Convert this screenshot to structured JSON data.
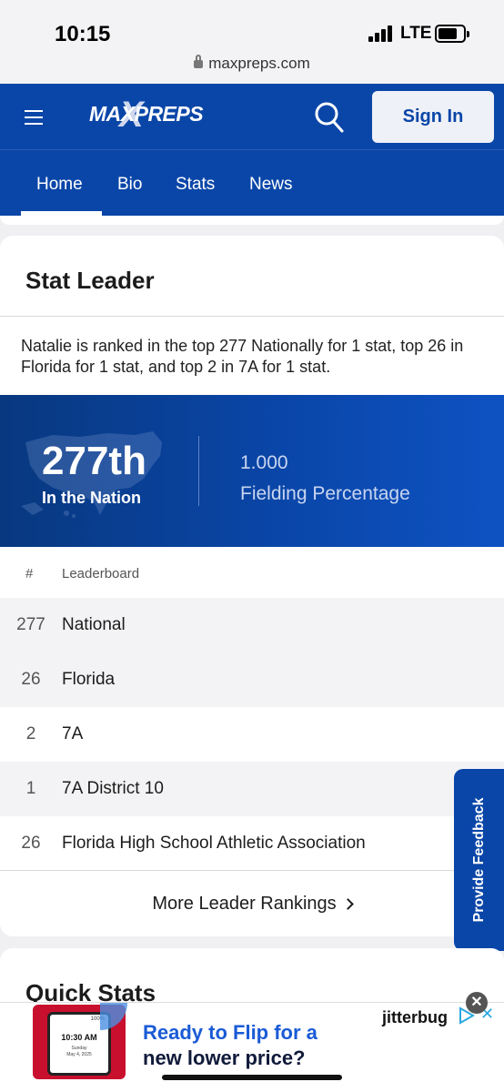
{
  "status_bar": {
    "time": "10:15",
    "network": "LTE",
    "url": "maxpreps.com"
  },
  "header": {
    "logo_text": "MAXPREPS",
    "sign_in_label": "Sign In"
  },
  "nav": {
    "tabs": [
      {
        "label": "Home",
        "active": true
      },
      {
        "label": "Bio"
      },
      {
        "label": "Stats"
      },
      {
        "label": "News"
      }
    ]
  },
  "stat_leader": {
    "title": "Stat Leader",
    "summary": "Natalie is ranked in the top 277 Nationally for 1 stat, top 26 in Florida for 1 stat, and top 2 in 7A for 1 stat.",
    "banner": {
      "rank": "277th",
      "rank_scope": "In the Nation",
      "stat_value": "1.000",
      "stat_name": "Fielding Percentage"
    },
    "table": {
      "headers": [
        "#",
        "Leaderboard"
      ],
      "rows": [
        {
          "rank": "277",
          "name": "National"
        },
        {
          "rank": "26",
          "name": "Florida"
        },
        {
          "rank": "2",
          "name": "7A"
        },
        {
          "rank": "1",
          "name": "7A District 10"
        },
        {
          "rank": "26",
          "name": "Florida High School Athletic Association"
        }
      ]
    },
    "more_link": "More Leader Rankings"
  },
  "feedback_tab": "Provide Feedback",
  "quick_stats": {
    "title": "Quick Stats"
  },
  "ad": {
    "headline_line1": "Ready to Flip for a",
    "headline_line2": "new lower price?",
    "brand": "jitterbug",
    "phone_screen": {
      "status": "100%",
      "time": "10:30 AM",
      "day": "Sunday",
      "date": "May 4, 2025"
    },
    "close_label": "✕"
  },
  "colors": {
    "brand_blue": "#0a46a8",
    "link_blue": "#1a5bd6"
  }
}
